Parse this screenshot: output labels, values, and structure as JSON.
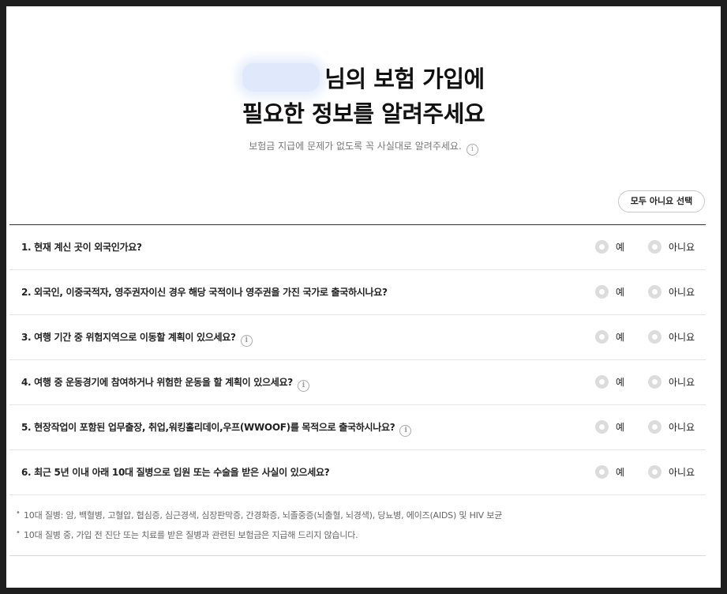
{
  "header": {
    "title_line1_suffix": "님의 보험 가입에",
    "title_line2": "필요한 정보를 알려주세요",
    "subtitle": "보험금 지급에 문제가 없도록 꼭 사실대로 알려주세요."
  },
  "actions": {
    "select_all_no": "모두 아니요 선택"
  },
  "options": {
    "yes": "예",
    "no": "아니요"
  },
  "questions": [
    {
      "text": "1. 현재 계신 곳이 외국인가요?"
    },
    {
      "text": "2. 외국인, 이중국적자, 영주권자이신 경우 해당 국적이나 영주권을 가진 국가로 출국하시나요?"
    },
    {
      "text": "3. 여행 기간 중 위험지역으로 이동할 계획이 있으세요?"
    },
    {
      "text": "4. 여행 중 운동경기에 참여하거나 위험한 운동을 할 계획이 있으세요?"
    },
    {
      "text": "5. 현장작업이 포함된 업무출장, 취업,워킹홀리데이,우프(WWOOF)를 목적으로 출국하시나요?"
    },
    {
      "text": "6. 최근 5년 이내 아래 10대 질병으로 입원 또는 수술을 받은 사실이 있으세요?"
    }
  ],
  "notes": [
    "10대 질병: 암, 백혈병, 고혈압, 협심증, 심근경색, 심장판막증, 간경화증, 뇌졸중증(뇌출혈, 뇌경색), 당뇨병, 에이즈(AIDS) 및 HIV 보균",
    "10대 질병 중, 가입 전 진단 또는 치료를 받은 질병과 관련된 보험금은 지급해 드리지 않습니다."
  ],
  "icons": {
    "info": "info-icon",
    "radio": "radio-icon"
  },
  "colors": {
    "radio_fill": "#dcdcdc",
    "divider_strong": "#333333",
    "divider_light": "#e4e4e4"
  }
}
